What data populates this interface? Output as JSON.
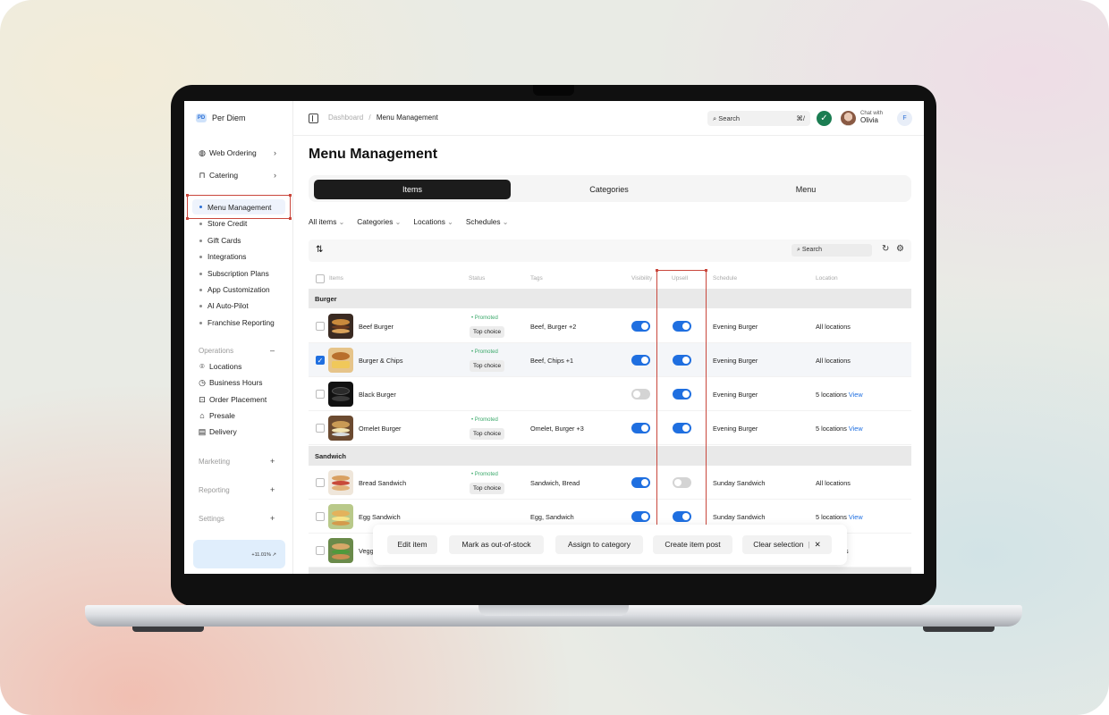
{
  "app": {
    "brand": "Per Diem",
    "brand_mark": "PerDiem"
  },
  "sidebar": {
    "nav": [
      {
        "label": "Web Ordering",
        "icon": "globe-icon"
      },
      {
        "label": "Catering",
        "icon": "bag-icon"
      }
    ],
    "items": [
      {
        "label": "Menu Management",
        "active": true
      },
      {
        "label": "Store Credit"
      },
      {
        "label": "Gift Cards"
      },
      {
        "label": "Integrations"
      },
      {
        "label": "Subscription Plans"
      },
      {
        "label": "App Customization"
      },
      {
        "label": "AI Auto-Pilot"
      },
      {
        "label": "Franchise Reporting"
      }
    ],
    "operations": {
      "label": "Operations",
      "toggle": "–",
      "items": [
        {
          "label": "Locations",
          "icon": "location-pin-icon"
        },
        {
          "label": "Business Hours",
          "icon": "clock-icon"
        },
        {
          "label": "Order Placement",
          "icon": "cart-icon"
        },
        {
          "label": "Presale",
          "icon": "store-icon"
        },
        {
          "label": "Delivery",
          "icon": "truck-icon"
        }
      ]
    },
    "sections": [
      {
        "label": "Marketing",
        "toggle": "+"
      },
      {
        "label": "Reporting",
        "toggle": "+"
      },
      {
        "label": "Settings",
        "toggle": "+"
      }
    ],
    "promo_stat": "+11.01% ↗"
  },
  "topbar": {
    "breadcrumb": [
      "Dashboard",
      "Menu Management"
    ],
    "separator": "/",
    "search_label": "Search",
    "search_shortcut": "⌘/",
    "chat_label": "Chat with",
    "chat_name": "Olivia",
    "user_initial": "F"
  },
  "page": {
    "title": "Menu Management",
    "tabs": [
      "Items",
      "Categories",
      "Menu"
    ],
    "active_tab": "Items"
  },
  "filters": [
    "All items",
    "Categories",
    "Locations",
    "Schedules"
  ],
  "table": {
    "search_label": "Search",
    "columns": [
      "Items",
      "Status",
      "Tags",
      "Visibility",
      "Upsell",
      "Schedule",
      "Location"
    ],
    "groups": [
      {
        "name": "Burger",
        "rows": [
          {
            "name": "Beef Burger",
            "promoted": "Promoted",
            "choice": "Top choice",
            "tags": "Beef, Burger +2",
            "visibility": true,
            "upsell": true,
            "schedule": "Evening Burger",
            "location": "All locations",
            "checked": false
          },
          {
            "name": "Burger & Chips",
            "promoted": "Promoted",
            "choice": "Top choice",
            "tags": "Beef, Chips +1",
            "visibility": true,
            "upsell": true,
            "schedule": "Evening Burger",
            "location": "All locations",
            "checked": true
          },
          {
            "name": "Black Burger",
            "promoted": "",
            "choice": "",
            "tags": "",
            "visibility": false,
            "upsell": true,
            "schedule": "Evening Burger",
            "location": "5 locations",
            "view": "View",
            "checked": false
          },
          {
            "name": "Omelet Burger",
            "promoted": "Promoted",
            "choice": "Top choice",
            "tags": "Omelet, Burger +3",
            "visibility": true,
            "upsell": true,
            "schedule": "Evening Burger",
            "location": "5 locations",
            "view": "View",
            "checked": false
          }
        ]
      },
      {
        "name": "Sandwich",
        "rows": [
          {
            "name": "Bread Sandwich",
            "promoted": "Promoted",
            "choice": "Top choice",
            "tags": "Sandwich, Bread",
            "visibility": true,
            "upsell": false,
            "schedule": "Sunday Sandwich",
            "location": "All locations",
            "checked": false
          },
          {
            "name": "Egg Sandwich",
            "promoted": "",
            "choice": "",
            "tags": "Egg, Sandwich",
            "visibility": true,
            "upsell": true,
            "schedule": "Sunday Sandwich",
            "location": "5 locations",
            "view": "View",
            "checked": false
          },
          {
            "name": "Vegg",
            "promoted": "",
            "choice": "",
            "tags": "",
            "visibility": null,
            "upsell": null,
            "schedule": "",
            "location": "ns",
            "checked": false
          }
        ]
      }
    ]
  },
  "actions": {
    "edit": "Edit item",
    "oos": "Mark as out-of-stock",
    "assign": "Assign to category",
    "create": "Create item post",
    "clear": "Clear selection",
    "close": "✕"
  },
  "colors": {
    "accent": "#1f6fe0",
    "highlight": "#c9473c",
    "promoted": "#3aa86a",
    "dark_tab": "#1c1c1c"
  }
}
